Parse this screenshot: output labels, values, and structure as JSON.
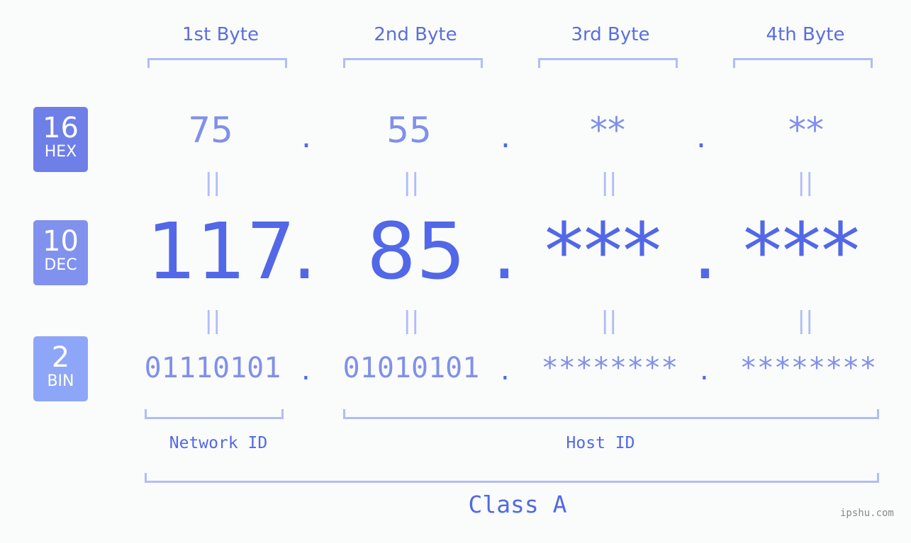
{
  "byte_headers": [
    "1st Byte",
    "2nd Byte",
    "3rd Byte",
    "4th Byte"
  ],
  "badges": [
    {
      "num": "16",
      "label": "HEX",
      "color": "#6e7fe8"
    },
    {
      "num": "10",
      "label": "DEC",
      "color": "#8092ee"
    },
    {
      "num": "2",
      "label": "BIN",
      "color": "#8ea6f7"
    }
  ],
  "hex": [
    "75",
    "55",
    "**",
    "**"
  ],
  "dec": [
    "117",
    "85",
    "***",
    "***"
  ],
  "bin": [
    "01110101",
    "01010101",
    "********",
    "********"
  ],
  "separator": ".",
  "equals": "||",
  "network_label": "Network ID",
  "host_label": "Host ID",
  "class_label": "Class A",
  "watermark": "ipshu.com"
}
